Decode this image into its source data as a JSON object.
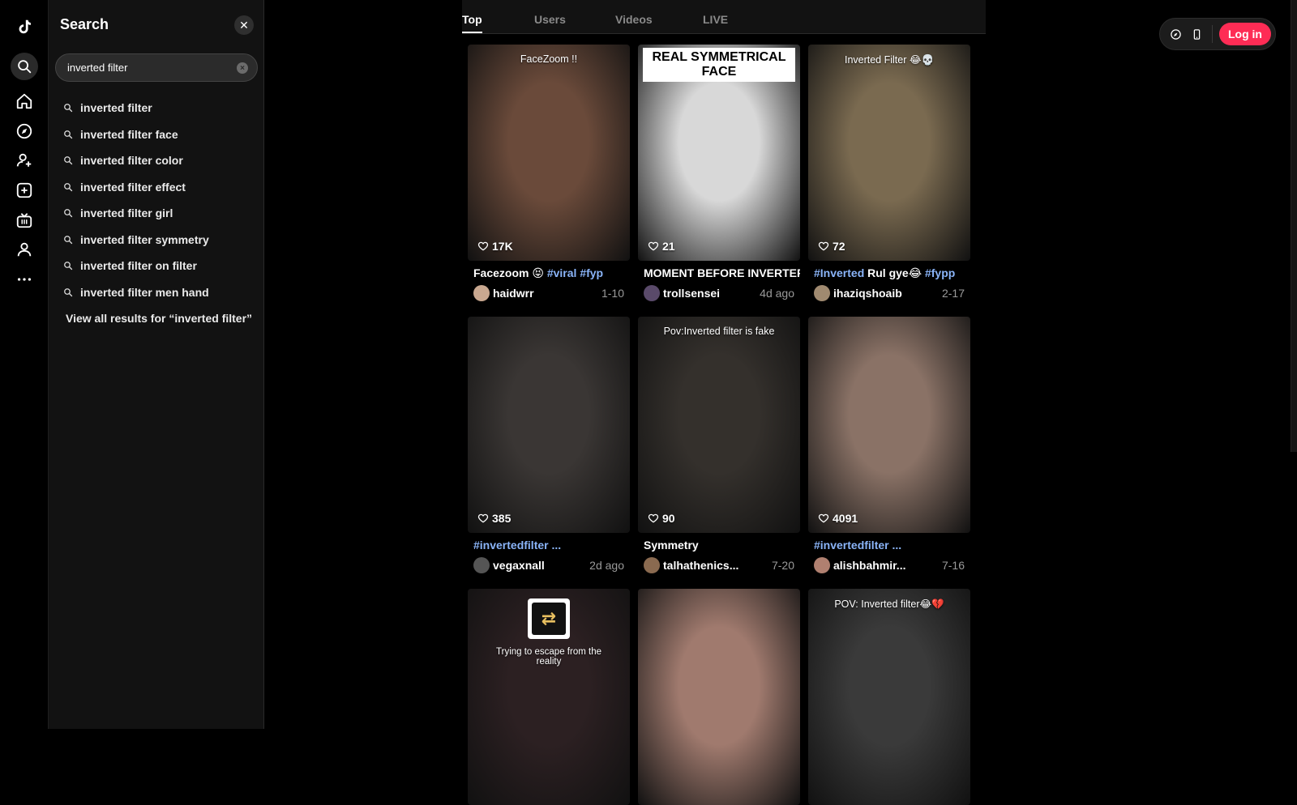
{
  "rail": {
    "icons": [
      "tiktok-logo-icon",
      "search-icon",
      "home-icon",
      "explore-icon",
      "following-icon",
      "upload-icon",
      "live-icon",
      "profile-icon",
      "more-icon"
    ]
  },
  "search_panel": {
    "title": "Search",
    "input_value": "inverted filter",
    "suggestions": [
      "inverted filter",
      "inverted filter face",
      "inverted filter color",
      "inverted filter effect",
      "inverted filter girl",
      "inverted filter symmetry",
      "inverted filter on filter",
      "inverted filter men hand"
    ],
    "view_all": "View all results for “inverted filter”"
  },
  "tabs": [
    "Top",
    "Users",
    "Videos",
    "LIVE"
  ],
  "active_tab": "Top",
  "topbar": {
    "login_label": "Log in"
  },
  "videos": [
    {
      "overlay": "FaceZoom !!",
      "likes": "17K",
      "caption_plain": "Facezoom 😝 ",
      "caption_tags": "#viral #fyp",
      "author": "haidwrr",
      "date": "1-10",
      "bg": "#6a4a3a"
    },
    {
      "overlay": "REAL SYMMETRICAL FACE",
      "likes": "21",
      "caption_plain": "MOMENT BEFORE INVERTER...",
      "caption_tags": "",
      "author": "trollsensei",
      "date": "4d ago",
      "bg": "#d8d8d8"
    },
    {
      "overlay": "Inverted Filter 😂💀",
      "likes": "72",
      "caption_tags": "#Inverted",
      "caption_plain": " Rul gye😂 ",
      "caption_tags2": "#fypp",
      "author": "ihaziqshoaib",
      "date": "2-17",
      "bg": "#7a6a50"
    },
    {
      "overlay": "",
      "likes": "385",
      "caption_tags": "#invertedfilter ...",
      "caption_plain": "",
      "author": "vegaxnall",
      "date": "2d ago",
      "bg": "#3a3634"
    },
    {
      "overlay": "Pov:Inverted filter is fake",
      "likes": "90",
      "caption_plain": "Symmetry",
      "caption_tags": "",
      "author": "talhathenics...",
      "date": "7-20",
      "bg": "#34302c"
    },
    {
      "overlay": "",
      "likes": "4091",
      "caption_tags": "#invertedfilter ...",
      "caption_plain": "",
      "author": "alishbahmir...",
      "date": "7-16",
      "bg": "#8a7266"
    },
    {
      "overlay": "Trying to escape from the reality",
      "likes": "",
      "caption_plain": "",
      "caption_tags": "",
      "author": "",
      "date": "",
      "bg": "#2c2022"
    },
    {
      "overlay": "",
      "likes": "",
      "caption_plain": "",
      "caption_tags": "",
      "author": "",
      "date": "",
      "bg": "#a07a6e"
    },
    {
      "overlay": "POV: Inverted filter😂💔",
      "likes": "",
      "caption_plain": "",
      "caption_tags": "",
      "author": "",
      "date": "",
      "bg": "#3a3a3a"
    }
  ]
}
